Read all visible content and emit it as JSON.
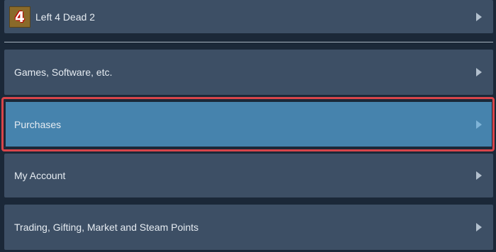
{
  "game": {
    "icon_glyph": "4",
    "label": "Left 4 Dead 2"
  },
  "menu": {
    "items": [
      {
        "label": "Games, Software, etc."
      },
      {
        "label": "Purchases"
      },
      {
        "label": "My Account"
      },
      {
        "label": "Trading, Gifting, Market and Steam Points"
      }
    ]
  },
  "colors": {
    "background": "#1b2838",
    "row": "#3d4f65",
    "selected_row": "#4683ad",
    "highlight": "#d8454a"
  },
  "icons": {
    "row_arrow": "chevron-right-icon"
  }
}
